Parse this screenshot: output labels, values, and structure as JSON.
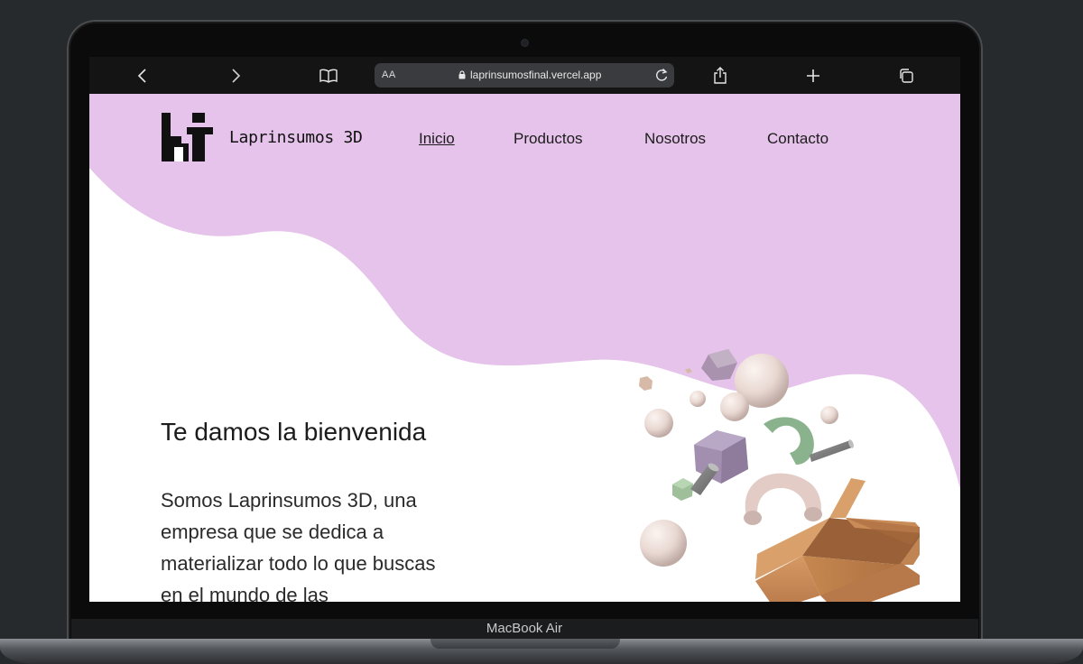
{
  "device": {
    "label": "MacBook Air"
  },
  "browser": {
    "text_size_label": "AA",
    "url": "laprinsumosfinal.vercel.app",
    "icons": [
      "back-icon",
      "forward-icon",
      "bookmarks-icon",
      "lock-icon",
      "reload-icon",
      "share-icon",
      "new-tab-icon",
      "tabs-icon"
    ]
  },
  "site": {
    "brand": "Laprinsumos 3D",
    "nav": [
      "Inicio",
      "Productos",
      "Nosotros",
      "Contacto"
    ],
    "active_nav": "Inicio",
    "hero": {
      "title": "Te damos la bienvenida",
      "text": "Somos Laprinsumos 3D, una empresa que se dedica a materializar todo lo que buscas en el mundo de las"
    },
    "colors": {
      "blob": "#e6c3ea",
      "text": "#1c1c1c",
      "frame": "#272a2c"
    }
  }
}
